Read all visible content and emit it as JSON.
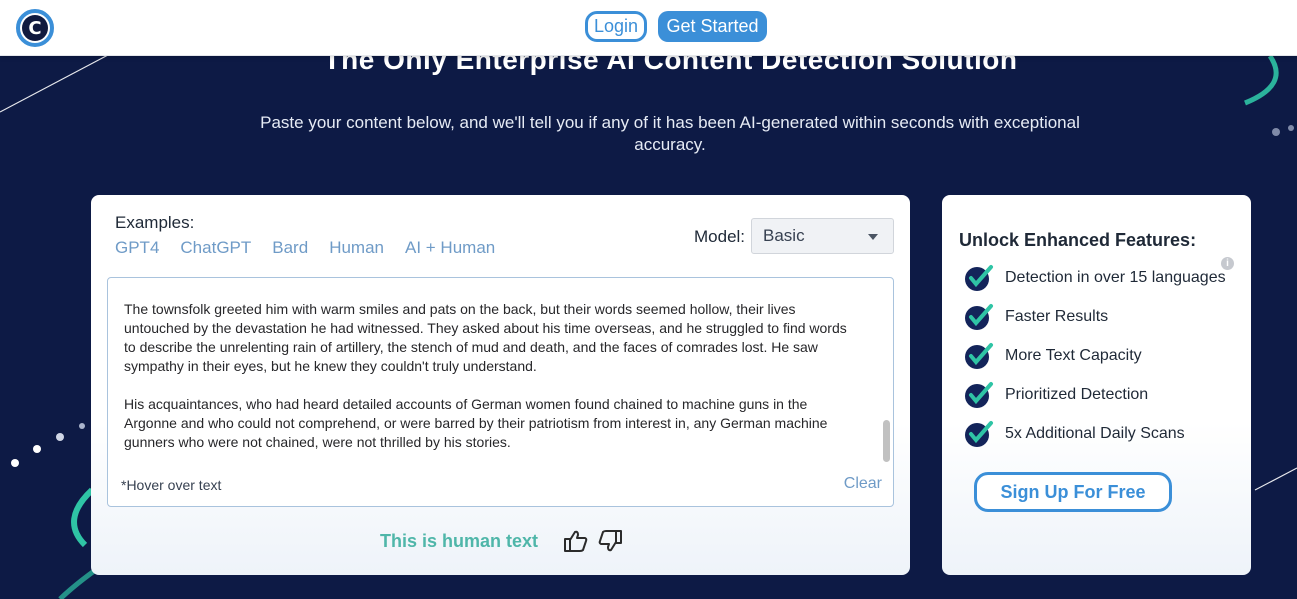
{
  "nav": {
    "logo_letter": "C",
    "login_label": "Login",
    "get_started_label": "Get Started"
  },
  "hero": {
    "title": "The Only Enterprise AI Content Detection Solution",
    "subtitle": "Paste your content below, and we'll tell you if any of it has been AI-generated within seconds with exceptional accuracy."
  },
  "detector": {
    "examples_label": "Examples:",
    "examples": [
      "GPT4",
      "ChatGPT",
      "Bard",
      "Human",
      "AI + Human"
    ],
    "model_label": "Model:",
    "model_value": "Basic",
    "paragraphs": [
      "The townsfolk greeted him with warm smiles and pats on the back, but their words seemed hollow, their lives untouched by the devastation he had witnessed. They asked about his time overseas, and he struggled to find words to describe the unrelenting rain of artillery, the stench of mud and death, and the faces of comrades lost. He saw sympathy in their eyes, but he knew they couldn't truly understand.",
      "His acquaintances, who had heard detailed accounts of German women found chained to machine guns in the Argonne and who could not comprehend, or were barred by their patriotism from interest in, any German machine gunners who were not chained, were not thrilled by his stories."
    ],
    "hover_note": "*Hover over text",
    "clear_label": "Clear",
    "verdict": "This is human text"
  },
  "side": {
    "title": "Unlock Enhanced Features:",
    "features": [
      "Detection in over 15 languages",
      "Faster Results",
      "More Text Capacity",
      "Prioritized Detection",
      "5x Additional Daily Scans"
    ],
    "signup_label": "Sign Up For Free"
  },
  "colors": {
    "background": "#0d1a45",
    "accent_blue": "#3b8fd8",
    "verdict_green": "#4fb6a9",
    "check_teal": "#2fc4a5",
    "check_navy": "#13245a"
  }
}
